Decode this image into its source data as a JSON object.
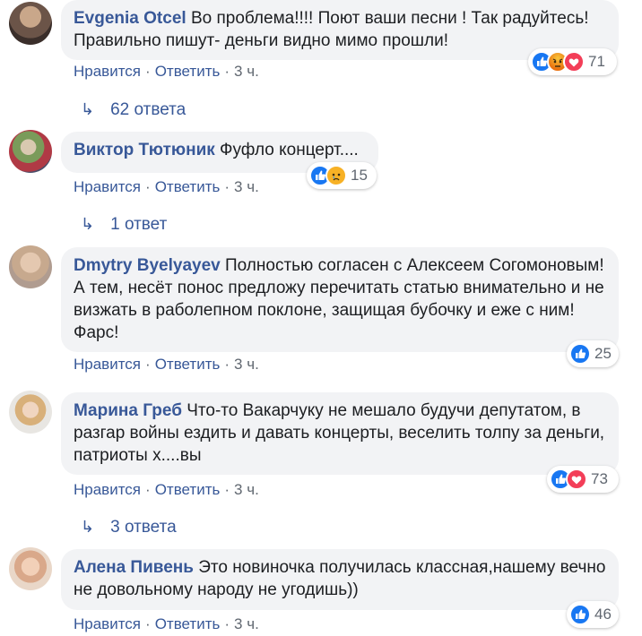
{
  "comments": [
    {
      "author": "Evgenia Otcel",
      "text": "Во проблема!!!! Поют ваши песни ! Так радуйтесь! Правильно пишут- деньги видно мимо прошли!",
      "like": "Нравится",
      "reply": "Ответить",
      "time": "3 ч.",
      "reaction_count": "71",
      "reaction_icons": [
        "like-icon",
        "angry-icon",
        "love-icon"
      ],
      "replies_label": "62 ответа"
    },
    {
      "author": "Виктор Тютюник",
      "text": "Фуфло концерт....",
      "like": "Нравится",
      "reply": "Ответить",
      "time": "3 ч.",
      "reaction_count": "15",
      "reaction_icons": [
        "like-icon",
        "sad-icon"
      ],
      "replies_label": "1 ответ"
    },
    {
      "author": "Dmytry Byelyayev",
      "text": "Полностью согласен с Алексеем Согомоновым! А тем, несёт понос предложу перечитать статью внимательно и не визжать в раболепном поклоне, защищая бубочку и еже с ним! Фарс!",
      "like": "Нравится",
      "reply": "Ответить",
      "time": "3 ч.",
      "reaction_count": "25",
      "reaction_icons": [
        "like-icon"
      ]
    },
    {
      "author": "Марина Греб",
      "text": "Что-то Вакарчуку не мешало будучи депутатом, в разгар войны ездить и давать концерты, веселить толпу за деньги, патриоты х....вы",
      "like": "Нравится",
      "reply": "Ответить",
      "time": "3 ч.",
      "reaction_count": "73",
      "reaction_icons": [
        "like-icon",
        "love-icon"
      ],
      "replies_label": "3 ответа"
    },
    {
      "author": "Алена Пивень",
      "text": "Это новиночка получилась классная,нашему вечно не довольному народу не угодишь))",
      "like": "Нравится",
      "reply": "Ответить",
      "time": "3 ч.",
      "reaction_count": "46",
      "reaction_icons": [
        "like-icon"
      ]
    }
  ],
  "colors": {
    "link": "#385898",
    "bubble": "#f2f3f5",
    "like": "#1877f2",
    "love": "#f33e58",
    "angry": "#e9710f",
    "sad": "#f7b125"
  }
}
